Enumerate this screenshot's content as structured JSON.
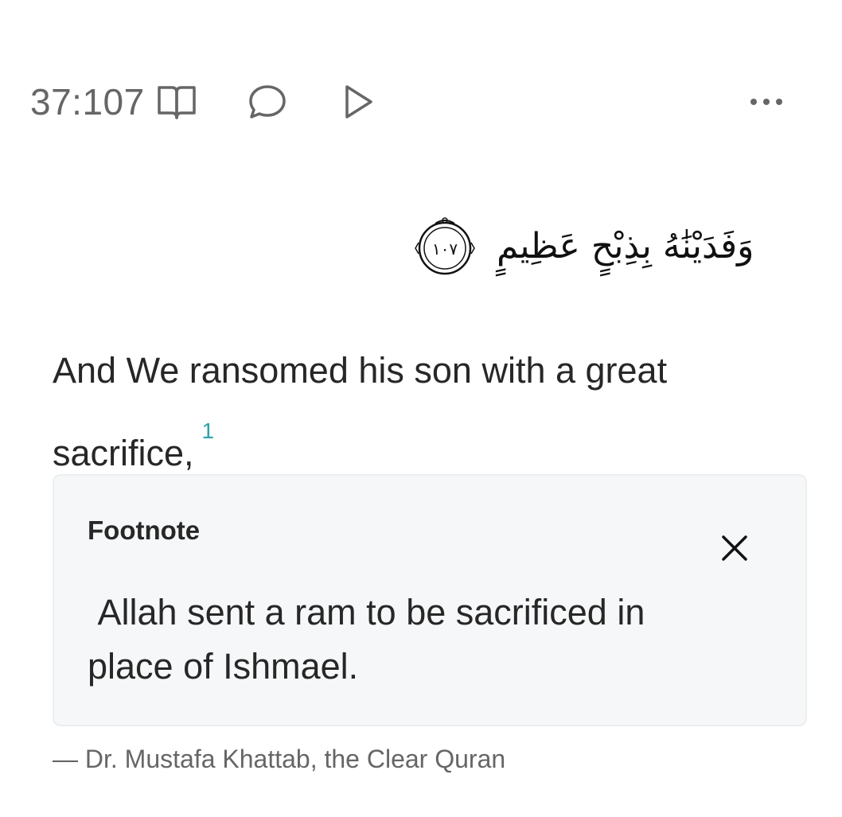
{
  "verse": {
    "key": "37:107",
    "arabic": "وَفَدَيْنَٰهُ بِذِبْحٍ عَظِيمٍ",
    "ayah_number": "١٠٧"
  },
  "toolbar": {
    "icons": [
      "book-icon",
      "comment-icon",
      "play-icon",
      "more-icon"
    ]
  },
  "translation": {
    "text": "And We ransomed his son with a great sacrifice,",
    "footnote_ref": "1"
  },
  "footnote": {
    "title": "Footnote",
    "text": " Allah sent a ram to be sacrificed in place of Ishmael."
  },
  "attribution": "— Dr. Mustafa Khattab, the Clear Quran",
  "colors": {
    "accent": "#2ca4ab",
    "muted_text": "#666666",
    "footnote_bg": "#f6f7f8"
  }
}
